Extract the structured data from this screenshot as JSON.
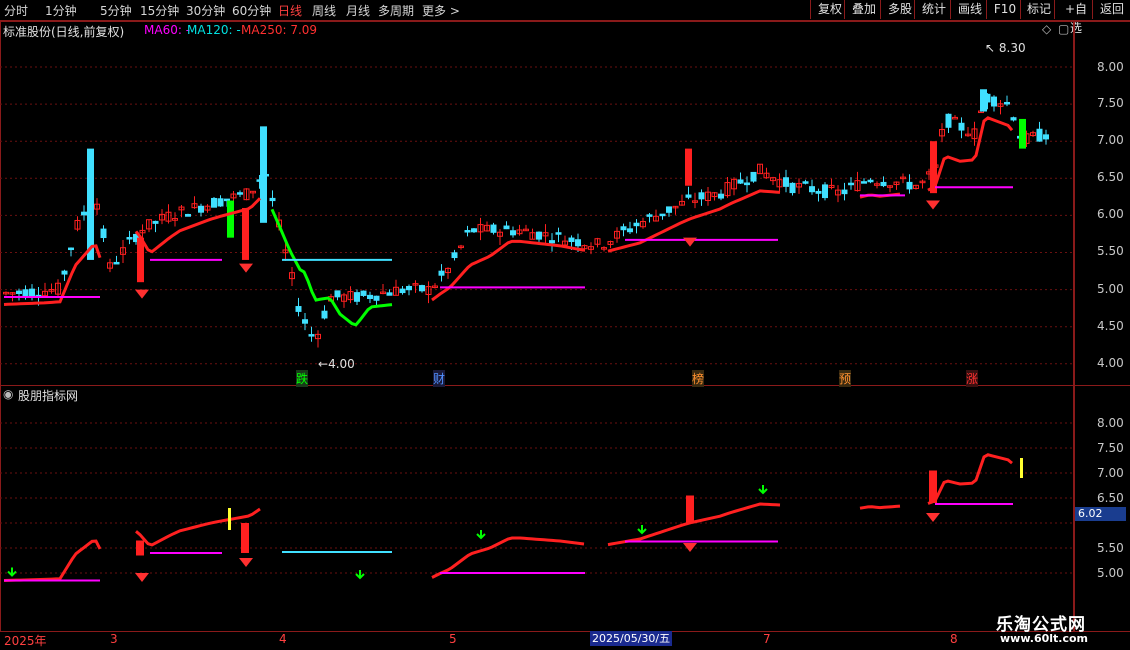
{
  "period_tabs": [
    "分时",
    "1分钟",
    "5分钟",
    "15分钟",
    "30分钟",
    "60分钟",
    "日线",
    "周线",
    "月线",
    "多周期",
    "更多 >"
  ],
  "right_buttons": [
    "复权",
    "叠加",
    "多股",
    "统计",
    "画线",
    "F10",
    "标记",
    "+自选",
    "返回"
  ],
  "main_header": {
    "title": "标准股份(日线,前复权)",
    "ma60": "MA60: -",
    "ma120": "MA120: -",
    "ma250": "MA250: 7.09",
    "ma60_color": "#ff00ff",
    "ma120_color": "#00e0e0",
    "ma250_color": "#ff3030"
  },
  "main_axis": [
    "8.00",
    "7.50",
    "7.00",
    "6.50",
    "6.00",
    "5.50",
    "5.00",
    "4.50",
    "4.00"
  ],
  "high_label": "8.30",
  "low_label": "4.00",
  "event_marks": [
    {
      "text": "跌",
      "color": "#00ff00"
    },
    {
      "text": "财",
      "color": "#5090ff"
    },
    {
      "text": "榜",
      "color": "#ff9030"
    },
    {
      "text": "预",
      "color": "#ff9030"
    },
    {
      "text": "涨",
      "color": "#ff3030"
    }
  ],
  "sub_header": {
    "title": "股朋指标网"
  },
  "sub_axis": [
    "8.00",
    "7.50",
    "7.00",
    "6.50",
    "6.00",
    "5.50",
    "5.00"
  ],
  "sub_price_tag": "6.02",
  "date_axis": [
    "2025年",
    "3",
    "4",
    "5",
    "7",
    "8"
  ],
  "date_highlight": "2025/05/30/五",
  "watermark": {
    "title": "乐淘公式网",
    "url": "www.60lt.com"
  },
  "colors": {
    "up": "#ff2020",
    "down": "#40e0ff",
    "grid": "#6a1010",
    "support": "#ff00ff",
    "trend_up": "#ff2020",
    "trend_down": "#00ff00"
  }
}
